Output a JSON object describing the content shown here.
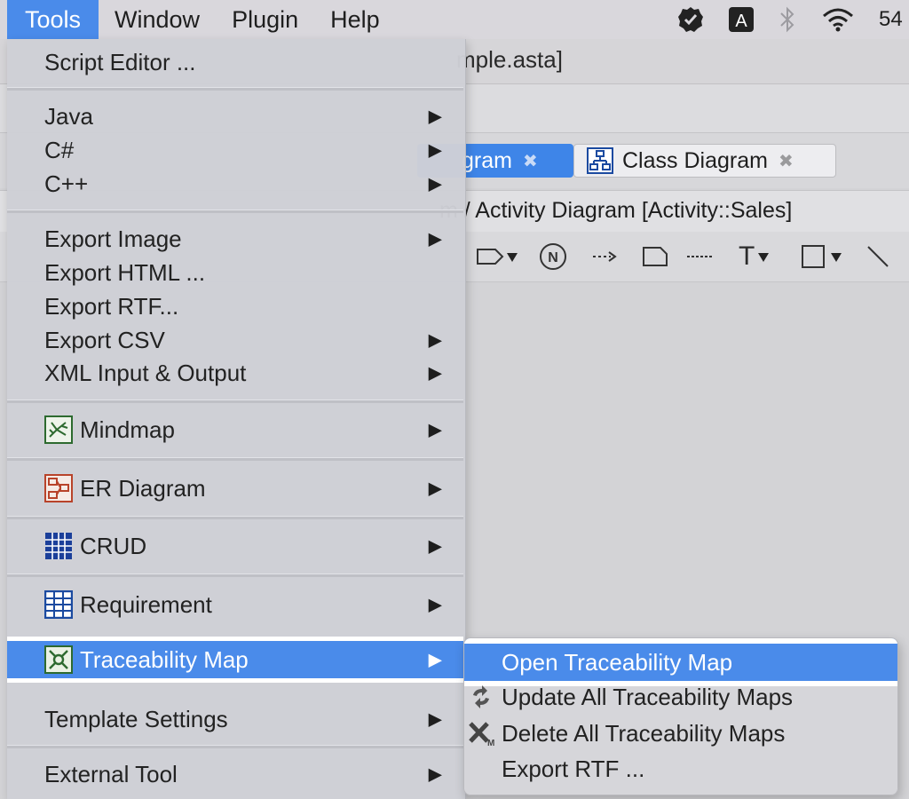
{
  "menubar": {
    "menus": [
      "Tools",
      "Window",
      "Plugin",
      "Help"
    ],
    "clock_partial": "54",
    "accent_color": "#4a8bea"
  },
  "window": {
    "title_partial": "mple.asta]"
  },
  "tabs": [
    {
      "label": "gram",
      "active": true
    },
    {
      "label": "Class Diagram",
      "active": false
    }
  ],
  "breadcrumb": "m / Activity Diagram [Activity::Sales]",
  "tools_menu": {
    "items": [
      {
        "label": "Script Editor ...",
        "submenu": false
      },
      {
        "label": "Java",
        "submenu": true
      },
      {
        "label": "C#",
        "submenu": true
      },
      {
        "label": "C++",
        "submenu": true
      },
      {
        "label": "Export Image",
        "submenu": true
      },
      {
        "label": "Export HTML ...",
        "submenu": false
      },
      {
        "label": "Export RTF...",
        "submenu": false
      },
      {
        "label": "Export CSV",
        "submenu": true
      },
      {
        "label": "XML Input & Output",
        "submenu": true
      },
      {
        "label": "Mindmap",
        "submenu": true,
        "icon": "mindmap-icon"
      },
      {
        "label": "ER Diagram",
        "submenu": true,
        "icon": "er-diagram-icon"
      },
      {
        "label": "CRUD",
        "submenu": true,
        "icon": "crud-grid-icon"
      },
      {
        "label": "Requirement",
        "submenu": true,
        "icon": "requirement-table-icon"
      },
      {
        "label": "Traceability Map",
        "submenu": true,
        "icon": "traceability-map-icon",
        "highlighted": true
      },
      {
        "label": "Template Settings",
        "submenu": true
      },
      {
        "label": "External Tool",
        "submenu": true
      }
    ]
  },
  "traceability_submenu": {
    "items": [
      {
        "label": "Open Traceability Map",
        "highlighted": true
      },
      {
        "label": "Update All Traceability Maps",
        "icon": "refresh-arrows-icon"
      },
      {
        "label": "Delete All Traceability Maps",
        "icon": "delete-x-icon"
      },
      {
        "label": "Export RTF ..."
      }
    ]
  },
  "submenu_arrow": "▶",
  "tab_close_glyph": "✖",
  "toolbar_text_tool": "T"
}
